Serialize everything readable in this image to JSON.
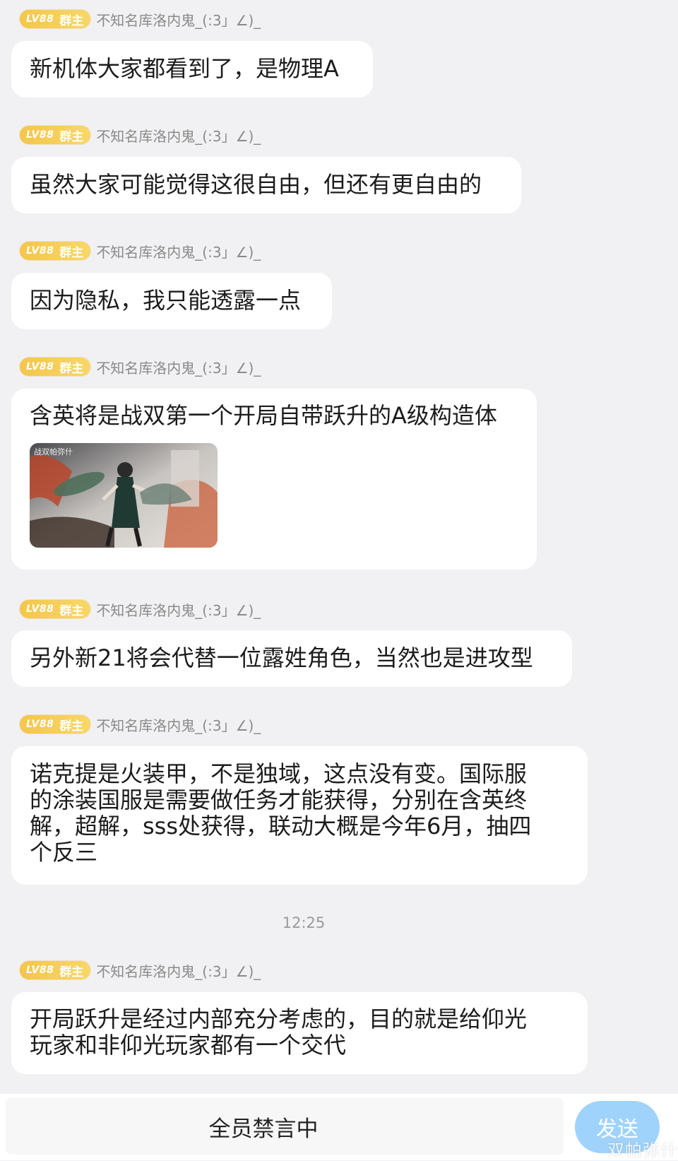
{
  "sender": {
    "level": "LV88",
    "role": "群主",
    "nickname": "不知名库洛内鬼_(:3」∠)_"
  },
  "messages": [
    {
      "lines": [
        "新机体大家都看到了，是物理A"
      ]
    },
    {
      "lines": [
        "虽然大家可能觉得这很自由，但还有更自由的"
      ]
    },
    {
      "lines": [
        "因为隐私，我只能透露一点"
      ]
    },
    {
      "lines": [
        "含英将是战双第一个开局自带跃升的A级构造体"
      ],
      "image_caption": "战双帕弥什"
    },
    {
      "lines": [
        "另外新21将会代替一位露姓角色，当然也是进攻型"
      ]
    },
    {
      "lines": [
        "诺克提是火装甲，不是独域，这点没有变。国际服",
        "的涂装国服是需要做任务才能获得，分别在含英终",
        "解，超解，sss处获得，联动大概是今年6月，抽四",
        "个反三"
      ]
    },
    {
      "lines": [
        "开局跃升是经过内部充分考虑的，目的就是给仰光",
        "玩家和非仰光玩家都有一个交代"
      ]
    }
  ],
  "timestamp": "12:25",
  "input": {
    "muted_text": "全员禁言中",
    "send_label": "发送"
  },
  "watermark": "双帕弥什",
  "colors": {
    "badge": "#f4c64b",
    "send_button": "#9fd3fb",
    "background": "#f1f1f3"
  }
}
